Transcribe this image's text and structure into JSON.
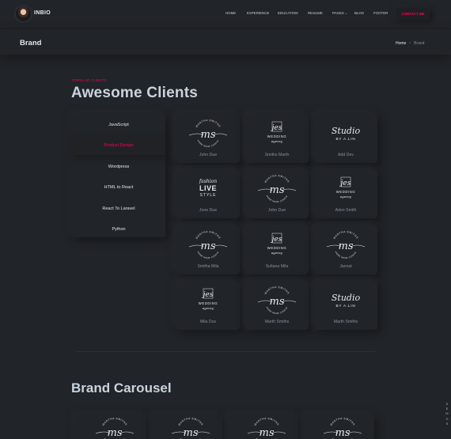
{
  "header": {
    "brand": "INBIO",
    "nav": [
      "HOME",
      "EXPERIENCE",
      "EDUCATION",
      "RESUME",
      "PAGES",
      "BLOG",
      "FOOTER"
    ],
    "contact": "CONTACT ME"
  },
  "breadcrumb": {
    "title": "Brand",
    "home": "Home",
    "separator": "•",
    "current": "Brand"
  },
  "section": {
    "subtitle": "POPULAR CLIENTS",
    "title": "Awesome Clients"
  },
  "tabs": [
    "JavaScript",
    "Product Design",
    "Wordpress",
    "HTML to React",
    "React To Laravel",
    "Python"
  ],
  "active_tab": "Product Design",
  "clients": [
    {
      "name": "John Due",
      "logo": "martha-smiths-logo"
    },
    {
      "name": "Smiths Marth",
      "logo": "jes-wedding-logo"
    },
    {
      "name": "Add Dev",
      "logo": "studio-by-alin-logo"
    },
    {
      "name": "Jone Due",
      "logo": "fashion-live-style-logo"
    },
    {
      "name": "John Due",
      "logo": "martha-smiths-logo"
    },
    {
      "name": "Adon Smith",
      "logo": "jes-wedding-logo"
    },
    {
      "name": "Smitha Mila",
      "logo": "martha-smiths-logo"
    },
    {
      "name": "Sultana Mila",
      "logo": "jes-wedding-logo"
    },
    {
      "name": "Jannat",
      "logo": "martha-smiths-logo"
    },
    {
      "name": "Mila Dus",
      "logo": "jes-wedding-logo"
    },
    {
      "name": "Marth Smiths",
      "logo": "martha-smiths-logo"
    },
    {
      "name": "Marth Smiths",
      "logo": "studio-by-alin-logo"
    }
  ],
  "logo_text": {
    "ms": "ms",
    "martha_top": "MARTHA SMITHS",
    "martha_bottom": "HOME MADE COOKIE",
    "jes": "jes",
    "wedding": "WEDDING",
    "agency": "agency",
    "studio": "Studio",
    "by_alin": "BY A.LIN",
    "fashion": "fashion",
    "live": "LIVE",
    "style": "STYLE"
  },
  "carousel": {
    "title": "Brand Carousel",
    "count": 4
  },
  "side_text": [
    "D",
    "E",
    "M",
    "O",
    "S"
  ],
  "colors": {
    "background": "#212428",
    "accent": "#ff014f",
    "text": "#c4cfde"
  }
}
